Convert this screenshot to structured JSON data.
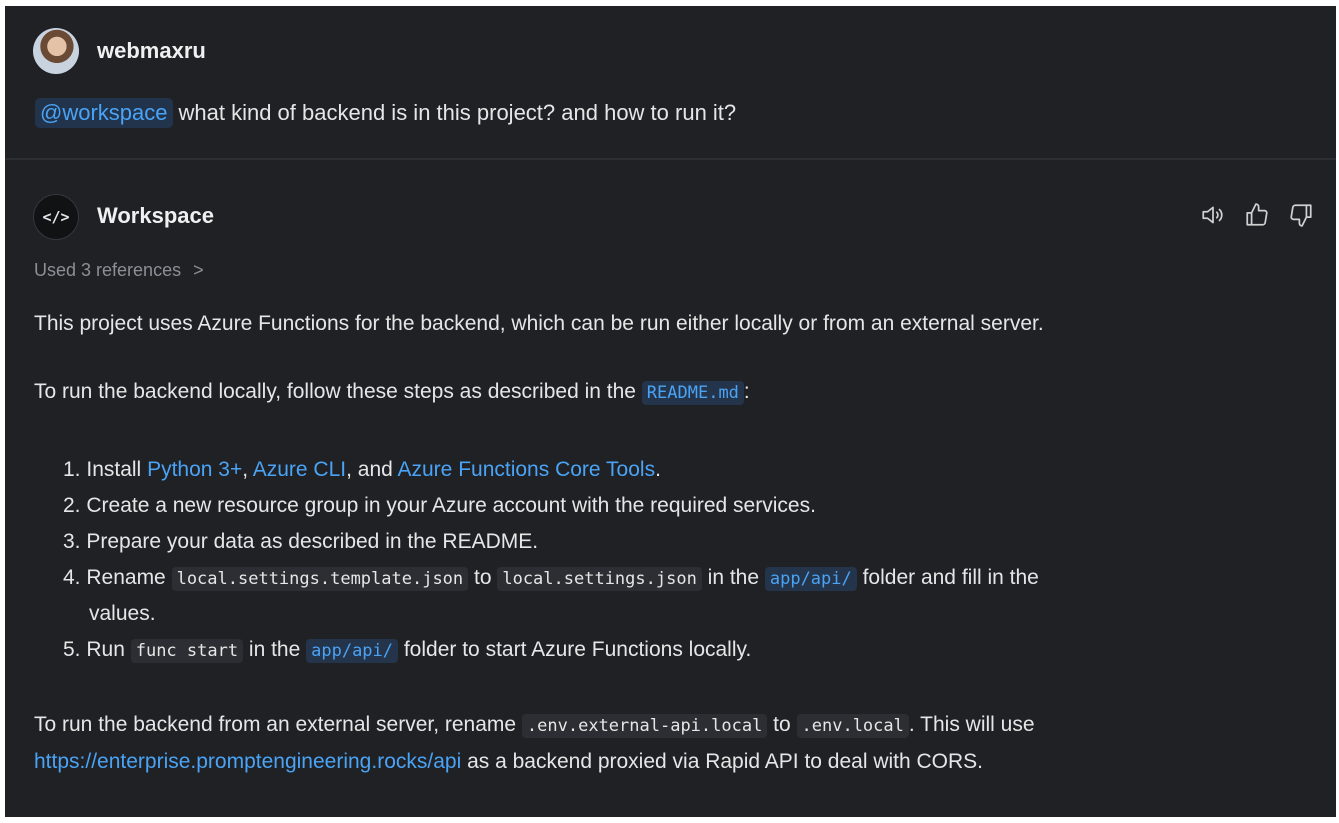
{
  "user": {
    "name": "webmaxru",
    "mention": "@workspace",
    "message": "what kind of backend is in this project? and how to run it?"
  },
  "assistant": {
    "name": "Workspace",
    "avatar_glyph": "</>",
    "icons": [
      "speaker-icon",
      "thumbs-up-icon",
      "thumbs-down-icon"
    ],
    "references_label": "Used 3 references",
    "references_chevron": ">",
    "intro": "This project uses Azure Functions for the backend, which can be run either locally or from an external server.",
    "local_intro": {
      "prefix": "To run the backend locally, follow these steps as described in the ",
      "file": "README.md",
      "suffix": ":"
    },
    "steps": [
      {
        "num": "1.",
        "t1": "Install ",
        "l1": "Python 3+",
        "t2": ", ",
        "l2": "Azure CLI",
        "t3": ", and ",
        "l3": "Azure Functions Core Tools",
        "t4": "."
      },
      {
        "num": "2.",
        "text": "Create a new resource group in your Azure account with the required services."
      },
      {
        "num": "3.",
        "text": "Prepare your data as described in the README."
      },
      {
        "num": "4.",
        "t1": "Rename ",
        "c1": "local.settings.template.json",
        "t2": " to ",
        "c2": "local.settings.json",
        "t3": " in the ",
        "c3": "app/api/",
        "t4": " folder and fill in the",
        "cont": "values."
      },
      {
        "num": "5.",
        "t1": "Run ",
        "c1": "func start",
        "t2": " in the ",
        "c2": "app/api/",
        "t3": " folder to start Azure Functions locally."
      }
    ],
    "external": {
      "t1": "To run the backend from an external server, rename ",
      "c1": ".env.external-api.local",
      "t2": " to ",
      "c2": ".env.local",
      "t3": ". This will use",
      "link": "https://enterprise.promptengineering.rocks/api",
      "t4": " as a backend proxied via Rapid API to deal with CORS."
    }
  },
  "colors": {
    "background": "#1f2125",
    "text": "#e6e6e6",
    "link": "#4aa3f5",
    "muted": "#8b8f96"
  }
}
